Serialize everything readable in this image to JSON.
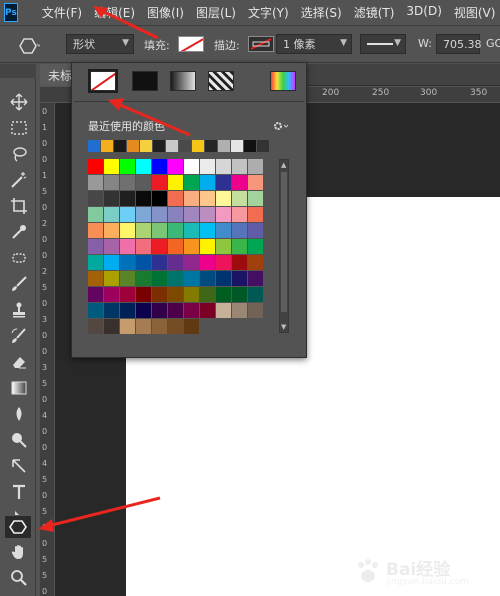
{
  "app": {
    "logo": "Ps"
  },
  "menu": {
    "items": [
      "文件(F)",
      "编辑(E)",
      "图像(I)",
      "图层(L)",
      "文字(Y)",
      "选择(S)",
      "滤镜(T)",
      "3D(D)",
      "视图(V)"
    ]
  },
  "options_bar": {
    "tool_mode": "形状",
    "fill_label": "填充:",
    "stroke_label": "描边:",
    "stroke_width": "1 像素",
    "width_label": "W:",
    "width_value": "705.38",
    "link_icon": "GO"
  },
  "document": {
    "tab_title": "未标"
  },
  "rulers": {
    "top": [
      "200",
      "250",
      "300",
      "350"
    ],
    "left": [
      "0",
      "1",
      "0",
      "0",
      "1",
      "5",
      "0",
      "2",
      "0",
      "0",
      "2",
      "5",
      "0",
      "3",
      "0",
      "0",
      "3",
      "5",
      "0",
      "4",
      "0",
      "0",
      "4",
      "5",
      "0",
      "5",
      "0",
      "0",
      "5",
      "5",
      "0"
    ]
  },
  "fill_panel": {
    "fill_types": [
      "no-color",
      "solid-color",
      "gradient",
      "pattern",
      "color-picker"
    ],
    "recent_label": "最近使用的颜色",
    "recent_colors": [
      "#1f6fd1",
      "#f2b01e",
      "#1a1a1a",
      "#e58a1f",
      "#f4d03f",
      "#202020",
      "#c9c9c9",
      "#4a4a4a",
      "#f5c518",
      "#262626",
      "#b0b0b0",
      "#e5e5e5",
      "#111111",
      "#333333"
    ],
    "swatches": [
      "#ff0000",
      "#ffff00",
      "#00ff00",
      "#00ffff",
      "#0000ff",
      "#ff00ff",
      "#ffffff",
      "#ebebeb",
      "#d6d6d6",
      "#c2c2c2",
      "#adadad",
      "#999999",
      "#858585",
      "#707070",
      "#5c5c5c",
      "#ed1c24",
      "#fff200",
      "#00a651",
      "#00aeef",
      "#2e3192",
      "#ec008c",
      "#f7977a",
      "#474747",
      "#333333",
      "#1f1f1f",
      "#0a0a0a",
      "#000000",
      "#f26c4f",
      "#f9ad81",
      "#fdc68a",
      "#fff79a",
      "#c4df9b",
      "#a2d39c",
      "#82ca9d",
      "#7bcdc8",
      "#6ecff6",
      "#7ea7d8",
      "#8493ca",
      "#8882be",
      "#a187be",
      "#bc8dbf",
      "#f49ac2",
      "#f6989d",
      "#f26c4f",
      "#f68e56",
      "#fbaf5d",
      "#fff568",
      "#acd373",
      "#7cc576",
      "#3bb878",
      "#1abbb4",
      "#00bff3",
      "#438ccb",
      "#5574b9",
      "#605ca8",
      "#855fa8",
      "#a763a8",
      "#f06ea9",
      "#f26d7d",
      "#ed1c24",
      "#f26522",
      "#f7941d",
      "#fff200",
      "#8dc63f",
      "#39b54a",
      "#00a651",
      "#00a99d",
      "#00aeef",
      "#0072bc",
      "#0054a6",
      "#2e3192",
      "#662d91",
      "#92278f",
      "#ec008c",
      "#ed145b",
      "#9e0b0f",
      "#a0410d",
      "#a36209",
      "#aba000",
      "#598527",
      "#197b30",
      "#007236",
      "#00746b",
      "#0076a3",
      "#004b80",
      "#003471",
      "#1b1464",
      "#440e62",
      "#630460",
      "#9e005d",
      "#9e0039",
      "#790000",
      "#7b2e00",
      "#7d4900",
      "#827b00",
      "#406618",
      "#005e20",
      "#005826",
      "#005952",
      "#005b7f",
      "#003663",
      "#002157",
      "#0d004c",
      "#32004b",
      "#4b0049",
      "#7b0046",
      "#7a0026",
      "#c7b299",
      "#998675",
      "#736357",
      "#534741",
      "#37302d",
      "#c69c6d",
      "#a67c52",
      "#8c6239",
      "#754c24",
      "#603913"
    ]
  },
  "watermark": {
    "brand": "Bai经验",
    "url": "jingyan.baidu.com"
  },
  "colors": {
    "annotation": "#e8261e",
    "panel": "#535353",
    "pasteboard": "#282828"
  }
}
